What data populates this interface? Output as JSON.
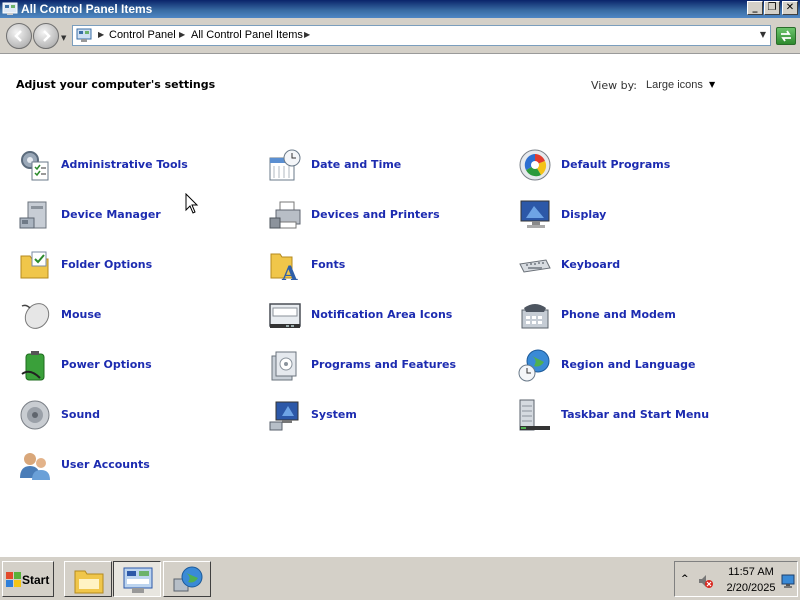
{
  "window": {
    "title": "All Control Panel Items"
  },
  "titlebar_buttons": {
    "minimize": "_",
    "maximize": "❐",
    "close": "✕"
  },
  "address": {
    "crumbs": [
      "Control Panel",
      "All Control Panel Items"
    ]
  },
  "header": {
    "heading": "Adjust your computer's settings",
    "view_by_label": "View by:",
    "view_by_value": "Large icons"
  },
  "items": [
    {
      "label": "Administrative Tools",
      "icon": "admin-tools-icon"
    },
    {
      "label": "Date and Time",
      "icon": "clock-calendar-icon"
    },
    {
      "label": "Default Programs",
      "icon": "default-programs-icon"
    },
    {
      "label": "Device Manager",
      "icon": "device-manager-icon"
    },
    {
      "label": "Devices and Printers",
      "icon": "printer-icon"
    },
    {
      "label": "Display",
      "icon": "monitor-icon"
    },
    {
      "label": "Folder Options",
      "icon": "folder-options-icon"
    },
    {
      "label": "Fonts",
      "icon": "fonts-folder-icon"
    },
    {
      "label": "Keyboard",
      "icon": "keyboard-icon"
    },
    {
      "label": "Mouse",
      "icon": "mouse-icon"
    },
    {
      "label": "Notification Area Icons",
      "icon": "notification-area-icon"
    },
    {
      "label": "Phone and Modem",
      "icon": "phone-modem-icon"
    },
    {
      "label": "Power Options",
      "icon": "battery-icon"
    },
    {
      "label": "Programs and Features",
      "icon": "programs-features-icon"
    },
    {
      "label": "Region and Language",
      "icon": "globe-clock-icon"
    },
    {
      "label": "Sound",
      "icon": "speaker-icon"
    },
    {
      "label": "System",
      "icon": "system-icon"
    },
    {
      "label": "Taskbar and Start Menu",
      "icon": "taskbar-icon"
    },
    {
      "label": "User Accounts",
      "icon": "users-icon"
    }
  ],
  "taskbar": {
    "start_label": "Start",
    "tasks": [
      "explorer-folder-icon",
      "control-panel-icon",
      "network-globe-icon"
    ],
    "clock_time": "11:57 AM",
    "clock_date": "2/20/2025"
  },
  "colors": {
    "link": "#1c2bb0",
    "titlebar": "#0a246a",
    "chrome": "#d4d0c8"
  }
}
